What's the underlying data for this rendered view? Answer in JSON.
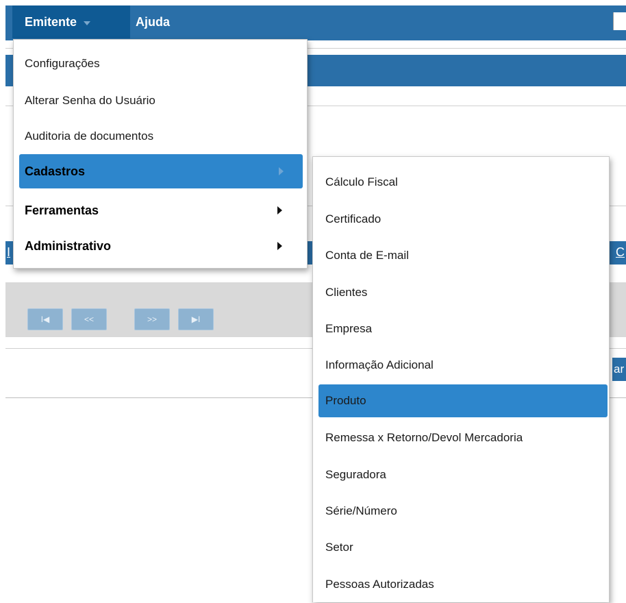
{
  "menubar": {
    "emitente_label": "Emitente",
    "ajuda_label": "Ajuda"
  },
  "dropdown": {
    "items": [
      {
        "label": "Configurações"
      },
      {
        "label": "Alterar Senha do Usuário"
      },
      {
        "label": "Auditoria de documentos"
      },
      {
        "label": "Cadastros"
      },
      {
        "label": "Ferramentas"
      },
      {
        "label": "Administrativo"
      }
    ]
  },
  "submenu": {
    "items": [
      {
        "label": "Cálculo Fiscal"
      },
      {
        "label": "Certificado"
      },
      {
        "label": "Conta de E-mail"
      },
      {
        "label": "Clientes"
      },
      {
        "label": "Empresa"
      },
      {
        "label": "Informação Adicional"
      },
      {
        "label": "Produto"
      },
      {
        "label": "Remessa x Retorno/Devol Mercadoria"
      },
      {
        "label": "Seguradora"
      },
      {
        "label": "Série/Número"
      },
      {
        "label": "Setor"
      },
      {
        "label": "Pessoas Autorizadas"
      }
    ]
  },
  "background": {
    "right_link_fragment": "C",
    "left_link_fragment": "I",
    "right_button_fragment": "ar",
    "pager": {
      "first": "I◀",
      "prev": "<<",
      "next": ">>",
      "last": "▶I"
    }
  },
  "colors": {
    "menubar": "#2a6fa8",
    "menubar_active": "#0f5a94",
    "highlight": "#2d86cc"
  }
}
